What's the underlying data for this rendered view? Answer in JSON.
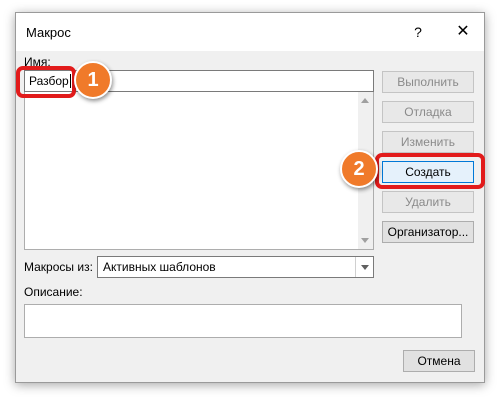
{
  "dialog": {
    "title": "Макрос",
    "help_label": "?",
    "close_label": "✕"
  },
  "form": {
    "name_label": "Имя:",
    "name_value": "Разбор",
    "macros_from_label": "Макросы из:",
    "macros_from_value": "Активных шаблонов",
    "description_label": "Описание:"
  },
  "buttons": {
    "run": "Выполнить",
    "debug": "Отладка",
    "edit": "Изменить",
    "create": "Создать",
    "delete": "Удалить",
    "organizer": "Организатор...",
    "cancel": "Отмена"
  },
  "annotations": {
    "step1": "1",
    "step2": "2",
    "highlight_color": "#e21b1b",
    "badge_color": "#f07a2a"
  }
}
